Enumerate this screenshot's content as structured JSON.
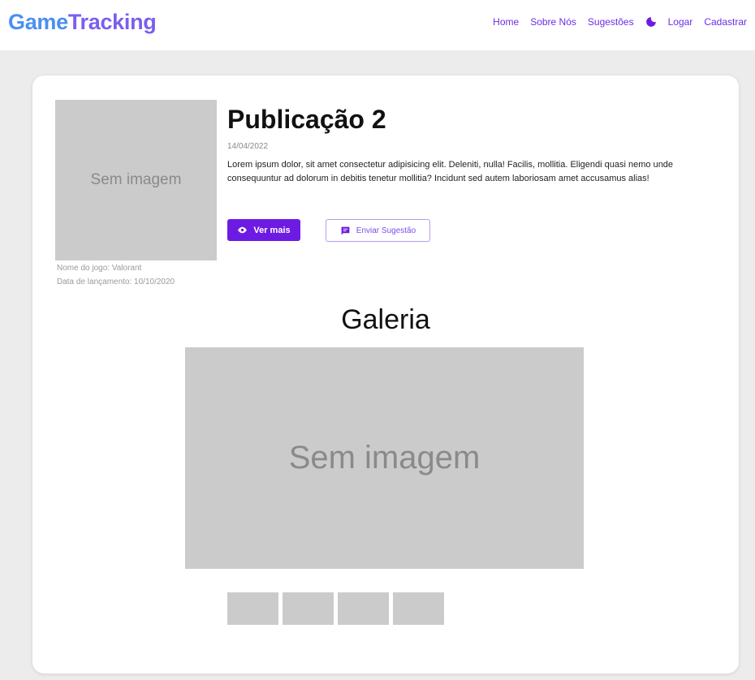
{
  "nav": {
    "logo_part1": "Game",
    "logo_part2": "Tracking",
    "links": [
      "Home",
      "Sobre Nós",
      "Sugestões",
      "Logar",
      "Cadastrar"
    ],
    "theme_icon": "moon-icon",
    "link_color": "#6d2de8"
  },
  "post": {
    "cover_placeholder": "Sem imagem",
    "game_name": "Nome do jogo: Valorant",
    "release_date": "Data de lançamento: 10/10/2020",
    "title": "Publicação 2",
    "date": "14/04/2022",
    "description": "Lorem ipsum dolor, sit amet consectetur adipisicing elit. Deleniti, nulla! Facilis, mollitia. Eligendi quasi nemo unde consequuntur ad dolorum in debitis tenetur mollitia? Incidunt sed autem laboriosam amet accusamus alias!",
    "view_more_label": "Ver mais",
    "view_more_icon": "eye-icon",
    "suggest_label": "Enviar Sugestão",
    "suggest_icon": "feedback-icon",
    "accent": "#6d1be2"
  },
  "gallery": {
    "title": "Galeria",
    "main_placeholder": "Sem imagem",
    "thumbnail_count": 4
  }
}
